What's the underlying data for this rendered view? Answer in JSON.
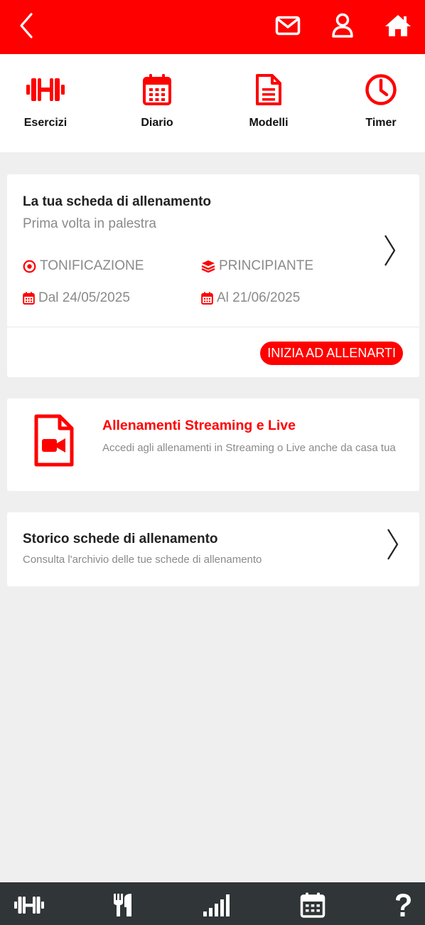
{
  "colors": {
    "accent": "#ff0000",
    "bottom_bar": "#303537"
  },
  "header": {
    "back_icon": "chevron-left-icon",
    "icons": [
      "mail-icon",
      "user-icon",
      "home-icon"
    ]
  },
  "shortcuts": [
    {
      "label": "Esercizi",
      "icon": "dumbbell-icon"
    },
    {
      "label": "Diario",
      "icon": "calendar-icon"
    },
    {
      "label": "Modelli",
      "icon": "document-icon"
    },
    {
      "label": "Timer",
      "icon": "clock-icon"
    }
  ],
  "plan_card": {
    "title": "La tua scheda di allenamento",
    "subtitle": "Prima volta in palestra",
    "goal": "TONIFICAZIONE",
    "level": "PRINCIPIANTE",
    "start_date": "Dal 24/05/2025",
    "end_date": "Al 21/06/2025",
    "cta": "INIZIA AD ALLENARTI"
  },
  "streaming_card": {
    "title": "Allenamenti Streaming e Live",
    "description": "Accedi agli allenamenti in Streaming o Live anche da casa tua"
  },
  "history_card": {
    "title": "Storico schede di allenamento",
    "description": "Consulta l'archivio delle tue schede di allenamento"
  },
  "bottom_nav": {
    "icons": [
      "dumbbell-icon",
      "fork-knife-icon",
      "signal-bars-icon",
      "calendar-icon",
      "question-icon"
    ]
  }
}
